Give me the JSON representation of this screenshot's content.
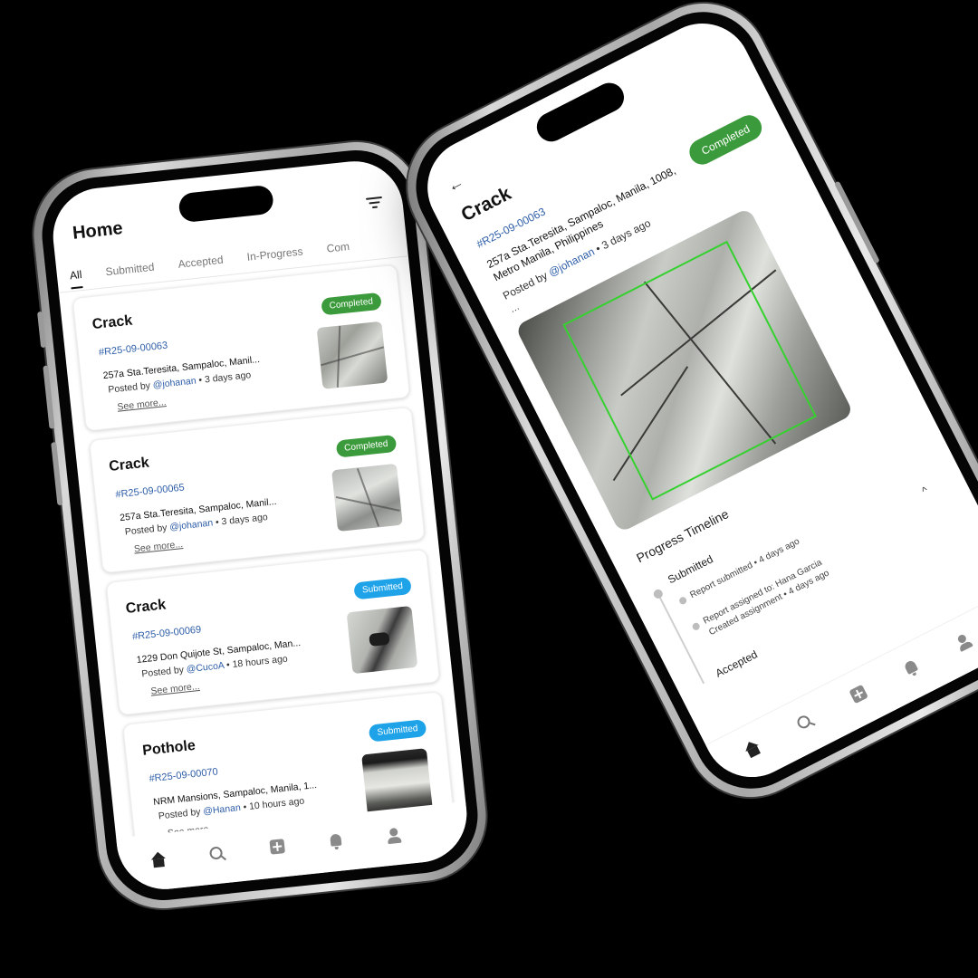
{
  "home": {
    "title": "Home",
    "tabs": [
      "All",
      "Submitted",
      "Accepted",
      "In-Progress",
      "Com"
    ],
    "cards": [
      {
        "title": "Crack",
        "status": "Completed",
        "status_color": "#3b9a3b",
        "id": "#R25-09-00063",
        "address": "257a Sta.Teresita, Sampaloc, Manil...",
        "posted_prefix": "Posted by ",
        "user": "@johanan",
        "time": " • 3 days ago",
        "see_more": "See more..."
      },
      {
        "title": "Crack",
        "status": "Completed",
        "status_color": "#3b9a3b",
        "id": "#R25-09-00065",
        "address": "257a Sta.Teresita, Sampaloc, Manil...",
        "posted_prefix": "Posted by ",
        "user": "@johanan",
        "time": " • 3 days ago",
        "see_more": "See more..."
      },
      {
        "title": "Crack",
        "status": "Submitted",
        "status_color": "#1fa3e8",
        "id": "#R25-09-00069",
        "address": "1229 Don Quijote St, Sampaloc, Man...",
        "posted_prefix": "Posted by ",
        "user": "@CucoA",
        "time": " • 18 hours ago",
        "see_more": "See more..."
      },
      {
        "title": "Pothole",
        "status": "Submitted",
        "status_color": "#1fa3e8",
        "id": "#R25-09-00070",
        "address": "NRM Mansions, Sampaloc, Manila, 1...",
        "posted_prefix": "Posted by ",
        "user": "@Hanan",
        "time": " • 10 hours ago",
        "see_more": "See more..."
      }
    ]
  },
  "detail": {
    "back": "←",
    "title": "Crack",
    "id": "#R25-09-00063",
    "status": "Completed",
    "status_color": "#3b9a3b",
    "address": "257a Sta.Teresita, Sampaloc, Manila, 1008, Metro Manila, Philippines",
    "posted_prefix": "Posted by ",
    "user": "@johanan",
    "time": " • 3 days ago",
    "more": "...",
    "section": "Progress Timeline",
    "timeline": {
      "stage": "Submitted",
      "lines": [
        "Report submitted • 4 days ago",
        "Report assigned to: Hana Garcia",
        "Created assignment • 4 days ago"
      ],
      "next_stage": "Accepted",
      "chevron": "^"
    }
  },
  "nav": {
    "icons": [
      "home-icon",
      "search-icon",
      "add-report-icon",
      "notifications-icon",
      "profile-icon"
    ]
  }
}
